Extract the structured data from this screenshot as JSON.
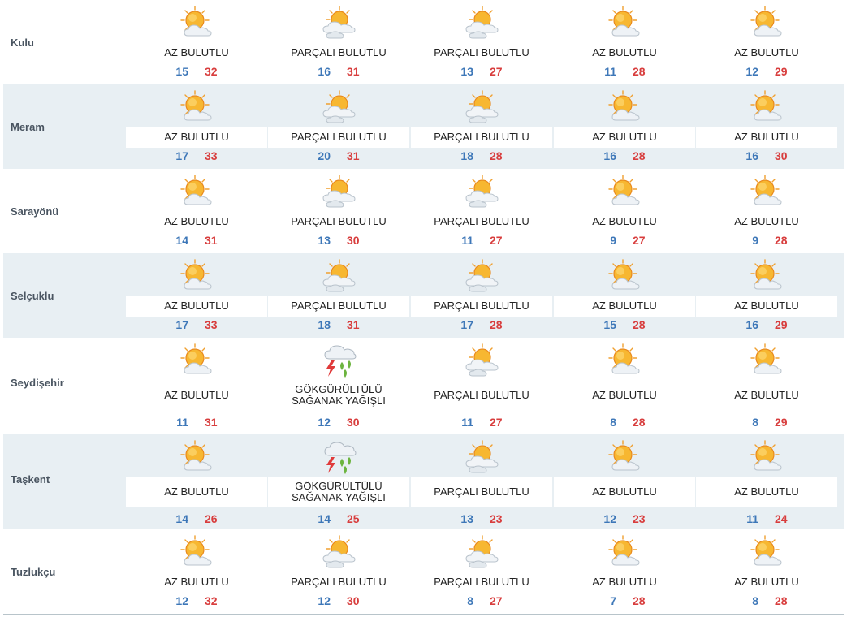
{
  "colors": {
    "min_temp": "#3d77b8",
    "max_temp": "#d83d3d",
    "row_shade": "#e8eff3",
    "district_text": "#4a5561"
  },
  "districts": [
    {
      "name": "Kulu",
      "days": [
        {
          "icon": "sun-cloud-icon",
          "condition": "AZ BULUTLU",
          "min": "15",
          "max": "32"
        },
        {
          "icon": "partly-cloudy-icon",
          "condition": "PARÇALI BULUTLU",
          "min": "16",
          "max": "31"
        },
        {
          "icon": "partly-cloudy-icon",
          "condition": "PARÇALI BULUTLU",
          "min": "13",
          "max": "27"
        },
        {
          "icon": "sun-cloud-icon",
          "condition": "AZ BULUTLU",
          "min": "11",
          "max": "28"
        },
        {
          "icon": "sun-cloud-icon",
          "condition": "AZ BULUTLU",
          "min": "12",
          "max": "29"
        }
      ]
    },
    {
      "name": "Meram",
      "days": [
        {
          "icon": "sun-cloud-icon",
          "condition": "AZ BULUTLU",
          "min": "17",
          "max": "33"
        },
        {
          "icon": "partly-cloudy-icon",
          "condition": "PARÇALI BULUTLU",
          "min": "20",
          "max": "31"
        },
        {
          "icon": "partly-cloudy-icon",
          "condition": "PARÇALI BULUTLU",
          "min": "18",
          "max": "28"
        },
        {
          "icon": "sun-cloud-icon",
          "condition": "AZ BULUTLU",
          "min": "16",
          "max": "28"
        },
        {
          "icon": "sun-cloud-icon",
          "condition": "AZ BULUTLU",
          "min": "16",
          "max": "30"
        }
      ]
    },
    {
      "name": "Sarayönü",
      "days": [
        {
          "icon": "sun-cloud-icon",
          "condition": "AZ BULUTLU",
          "min": "14",
          "max": "31"
        },
        {
          "icon": "partly-cloudy-icon",
          "condition": "PARÇALI BULUTLU",
          "min": "13",
          "max": "30"
        },
        {
          "icon": "partly-cloudy-icon",
          "condition": "PARÇALI BULUTLU",
          "min": "11",
          "max": "27"
        },
        {
          "icon": "sun-cloud-icon",
          "condition": "AZ BULUTLU",
          "min": "9",
          "max": "27"
        },
        {
          "icon": "sun-cloud-icon",
          "condition": "AZ BULUTLU",
          "min": "9",
          "max": "28"
        }
      ]
    },
    {
      "name": "Selçuklu",
      "days": [
        {
          "icon": "sun-cloud-icon",
          "condition": "AZ BULUTLU",
          "min": "17",
          "max": "33"
        },
        {
          "icon": "partly-cloudy-icon",
          "condition": "PARÇALI BULUTLU",
          "min": "18",
          "max": "31"
        },
        {
          "icon": "partly-cloudy-icon",
          "condition": "PARÇALI BULUTLU",
          "min": "17",
          "max": "28"
        },
        {
          "icon": "sun-cloud-icon",
          "condition": "AZ BULUTLU",
          "min": "15",
          "max": "28"
        },
        {
          "icon": "sun-cloud-icon",
          "condition": "AZ BULUTLU",
          "min": "16",
          "max": "29"
        }
      ]
    },
    {
      "name": "Seydişehir",
      "days": [
        {
          "icon": "sun-cloud-icon",
          "condition": "AZ BULUTLU",
          "min": "11",
          "max": "31"
        },
        {
          "icon": "thunder-shower-icon",
          "condition": "GÖKGÜRÜLTÜLÜ SAĞANAK YAĞIŞLI",
          "min": "12",
          "max": "30"
        },
        {
          "icon": "partly-cloudy-icon",
          "condition": "PARÇALI BULUTLU",
          "min": "11",
          "max": "27"
        },
        {
          "icon": "sun-cloud-icon",
          "condition": "AZ BULUTLU",
          "min": "8",
          "max": "28"
        },
        {
          "icon": "sun-cloud-icon",
          "condition": "AZ BULUTLU",
          "min": "8",
          "max": "29"
        }
      ]
    },
    {
      "name": "Taşkent",
      "days": [
        {
          "icon": "sun-cloud-icon",
          "condition": "AZ BULUTLU",
          "min": "14",
          "max": "26"
        },
        {
          "icon": "thunder-shower-icon",
          "condition": "GÖKGÜRÜLTÜLÜ SAĞANAK YAĞIŞLI",
          "min": "14",
          "max": "25"
        },
        {
          "icon": "partly-cloudy-icon",
          "condition": "PARÇALI BULUTLU",
          "min": "13",
          "max": "23"
        },
        {
          "icon": "sun-cloud-icon",
          "condition": "AZ BULUTLU",
          "min": "12",
          "max": "23"
        },
        {
          "icon": "sun-cloud-icon",
          "condition": "AZ BULUTLU",
          "min": "11",
          "max": "24"
        }
      ]
    },
    {
      "name": "Tuzlukçu",
      "days": [
        {
          "icon": "sun-cloud-icon",
          "condition": "AZ BULUTLU",
          "min": "12",
          "max": "32"
        },
        {
          "icon": "partly-cloudy-icon",
          "condition": "PARÇALI BULUTLU",
          "min": "12",
          "max": "30"
        },
        {
          "icon": "partly-cloudy-icon",
          "condition": "PARÇALI BULUTLU",
          "min": "8",
          "max": "27"
        },
        {
          "icon": "sun-cloud-icon",
          "condition": "AZ BULUTLU",
          "min": "7",
          "max": "28"
        },
        {
          "icon": "sun-cloud-icon",
          "condition": "AZ BULUTLU",
          "min": "8",
          "max": "28"
        }
      ]
    }
  ]
}
